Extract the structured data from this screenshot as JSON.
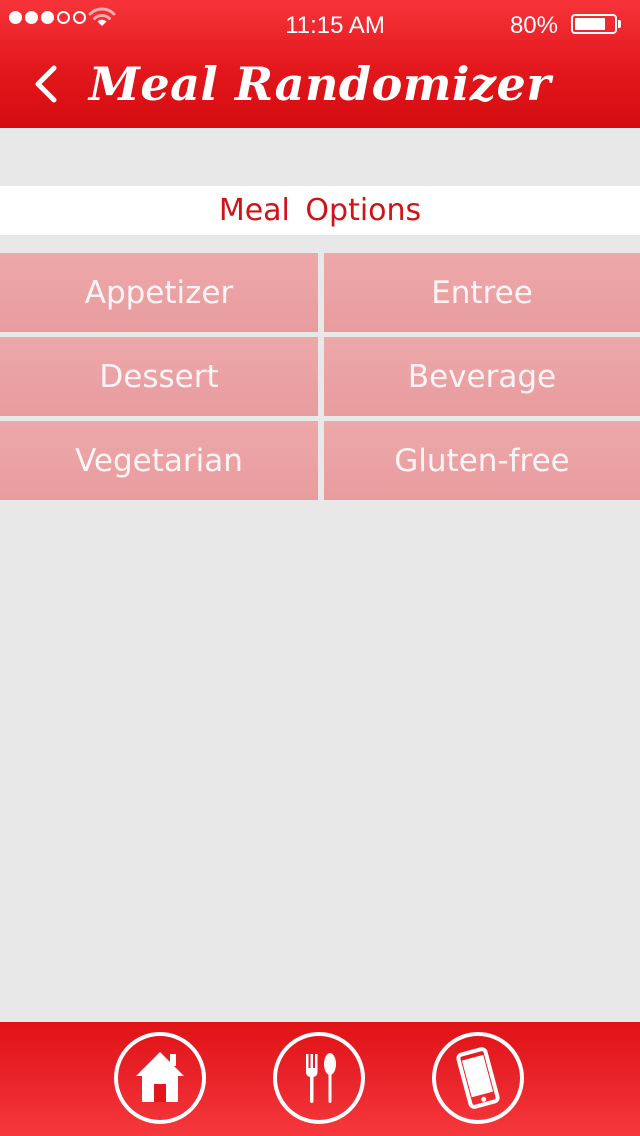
{
  "status_bar": {
    "signal_bars_filled": 3,
    "signal_bars_total": 5,
    "time": "11:15 AM",
    "battery_percent": "80%",
    "battery_level": 0.8
  },
  "header": {
    "title": "Meal Randomizer",
    "back_icon": "chevron-left-icon"
  },
  "section": {
    "title": "Meal Options"
  },
  "options": [
    {
      "label": "Appetizer"
    },
    {
      "label": "Entree"
    },
    {
      "label": "Dessert"
    },
    {
      "label": "Beverage"
    },
    {
      "label": "Vegetarian"
    },
    {
      "label": "Gluten-free"
    }
  ],
  "bottom_nav": [
    {
      "icon": "home-icon"
    },
    {
      "icon": "fork-spoon-icon"
    },
    {
      "icon": "phone-icon"
    }
  ],
  "colors": {
    "brand_red": "#e2171c",
    "option_bg": "#eba4a6",
    "background": "#e8e8e8",
    "section_text": "#cf1316"
  }
}
